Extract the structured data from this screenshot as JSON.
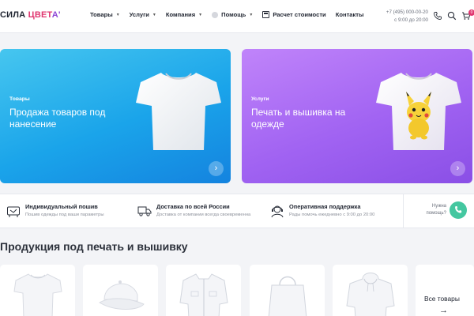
{
  "header": {
    "logo": {
      "part1": "СИЛА ",
      "part2": "ЦВЕТ",
      "part3": "А'"
    },
    "nav": [
      {
        "label": "Товары",
        "has_dropdown": true
      },
      {
        "label": "Услуги",
        "has_dropdown": true
      },
      {
        "label": "Компания",
        "has_dropdown": true
      },
      {
        "label": "Помощь",
        "has_dropdown": true
      },
      {
        "label": "Расчет стоимости",
        "has_dropdown": false
      },
      {
        "label": "Контакты",
        "has_dropdown": false
      }
    ],
    "phone": "+7 (495) 000-00-20",
    "hours": "с 9:00 до 20:00",
    "cart_count": "0",
    "icons": [
      "callback-icon",
      "search-icon",
      "cart-icon"
    ]
  },
  "banners": [
    {
      "tag": "Товары",
      "title": "Продажа товаров под нанесение",
      "color": "#1aa4ea"
    },
    {
      "tag": "Услуги",
      "title": "Печать и вышивка на одежде",
      "color": "#a163f2"
    }
  ],
  "features": [
    {
      "title": "Индивидуальный пошив",
      "subtitle": "Пошив одежды под ваши параметры",
      "icon": "sewing-icon"
    },
    {
      "title": "Доставка по всей России",
      "subtitle": "Доставка от компании всегда своевременна",
      "icon": "truck-icon"
    },
    {
      "title": "Оперативная поддержка",
      "subtitle": "Рады помочь ежедневно с 9:00 до 20:00",
      "icon": "support-icon"
    }
  ],
  "need_help": {
    "label": "Нужна помощь?"
  },
  "section": {
    "title": "Продукция под печать и вышивку"
  },
  "products": [
    {
      "name": "tshirt",
      "icon": "tshirt-icon"
    },
    {
      "name": "cap",
      "icon": "cap-icon"
    },
    {
      "name": "jacket",
      "icon": "jacket-icon"
    },
    {
      "name": "bag",
      "icon": "bag-icon"
    },
    {
      "name": "hoodie",
      "icon": "hoodie-icon"
    }
  ],
  "all_products": {
    "label": "Все товары",
    "arrow": "→"
  },
  "colors": {
    "accent_pink": "#e0356f",
    "accent_purple": "#8e47d6",
    "help_green": "#44c7a0"
  }
}
